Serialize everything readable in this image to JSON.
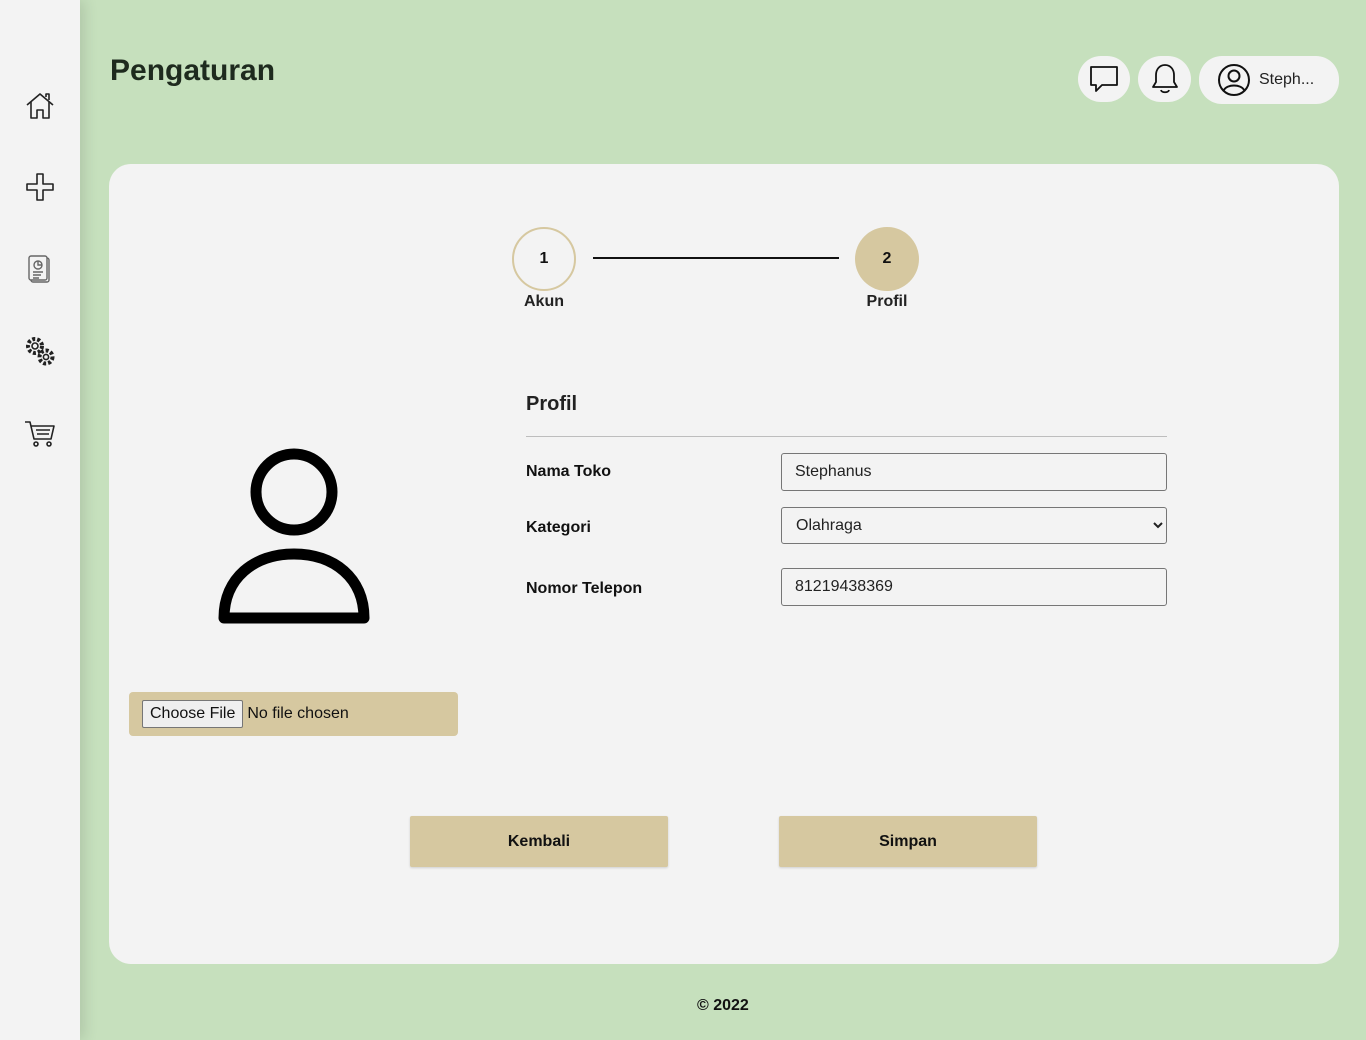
{
  "header": {
    "title": "Pengaturan",
    "user_name": "Steph..."
  },
  "sidebar": {
    "items": [
      {
        "icon": "home-icon"
      },
      {
        "icon": "plus-icon"
      },
      {
        "icon": "report-icon"
      },
      {
        "icon": "gears-icon"
      },
      {
        "icon": "cart-icon"
      }
    ]
  },
  "stepper": {
    "steps": [
      {
        "number": "1",
        "label": "Akun",
        "active": false
      },
      {
        "number": "2",
        "label": "Profil",
        "active": true
      }
    ]
  },
  "upload": {
    "button_label": "Choose File",
    "status": "No file chosen"
  },
  "form": {
    "section_title": "Profil",
    "fields": [
      {
        "label": "Nama Toko",
        "value": "Stephanus"
      },
      {
        "label": "Kategori",
        "value": "Olahraga"
      },
      {
        "label": "Nomor Telepon",
        "value": "81219438369"
      }
    ]
  },
  "actions": {
    "back_label": "Kembali",
    "save_label": "Simpan"
  },
  "footer": {
    "text": "© 2022"
  },
  "colors": {
    "background": "#c6e0bd",
    "panel": "#f3f3f3",
    "accent": "#d6c8a0"
  }
}
